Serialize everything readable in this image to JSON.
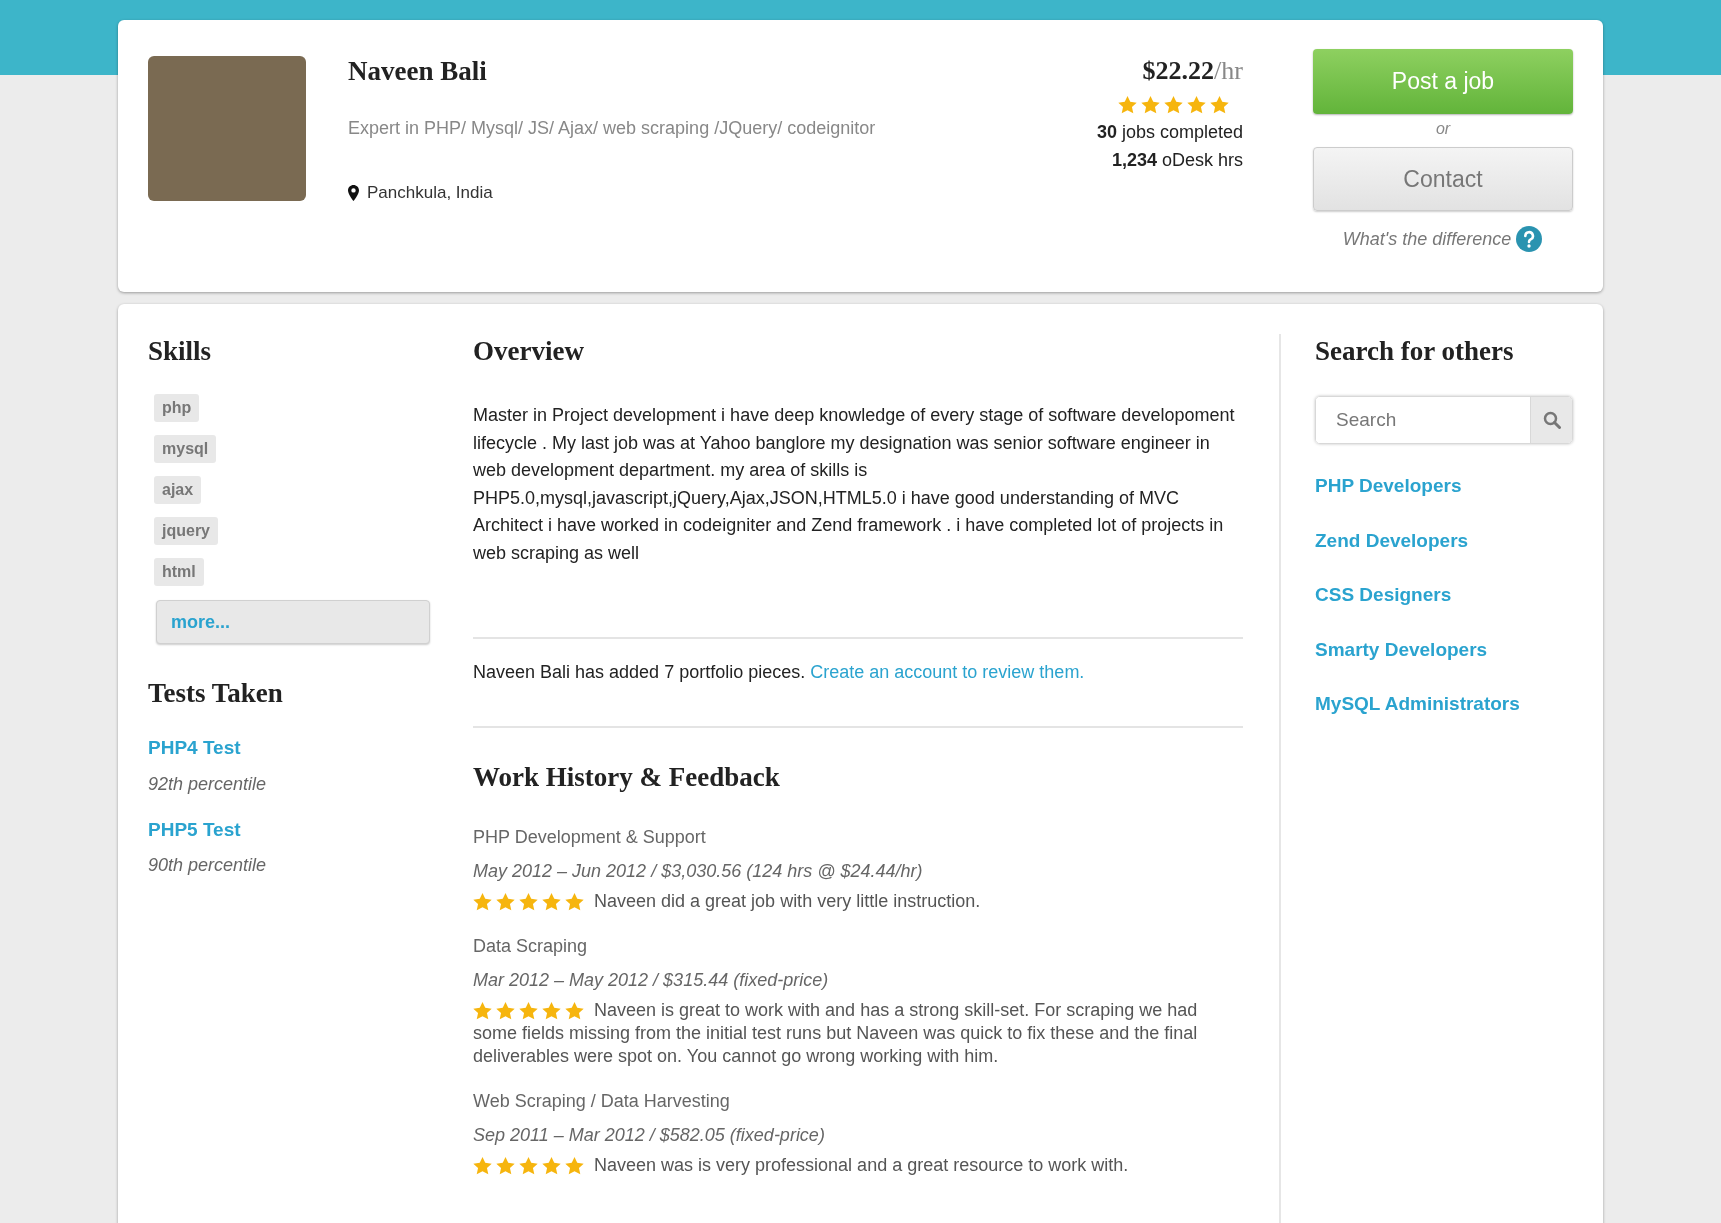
{
  "profile": {
    "name": "Naveen Bali",
    "tagline": "Expert in PHP/ Mysql/ JS/ Ajax/ web scraping /JQuery/ codeignitor",
    "location": "Panchkula, India",
    "rate": "$22.22",
    "rate_unit": "/hr",
    "stars": 5,
    "jobs_completed": "**30** jobs completed",
    "hours": "**1,234** oDesk hrs"
  },
  "actions": {
    "primary": "Post a job",
    "separator": "or",
    "secondary": "Contact",
    "help_link": "What's the difference"
  },
  "skills": {
    "title": "Skills",
    "tags": [
      "php",
      "mysql",
      "ajax",
      "jquery",
      "html"
    ],
    "more": "more..."
  },
  "tests": {
    "title": "Tests Taken",
    "items": [
      {
        "name": "PHP4 Test",
        "result": "92th percentile"
      },
      {
        "name": "PHP5 Test",
        "result": "90th percentile"
      }
    ]
  },
  "overview": {
    "title": "Overview",
    "text": "Master in Project development i have deep knowledge of every stage of software developoment lifecycle . My last job was at Yahoo banglore my designation was senior software engineer in web development department. my area of skills is PHP5.0,mysql,javascript,jQuery,Ajax,JSON,HTML5.0 i have good understanding of MVC Architect i have worked in codeigniter and Zend framework . i have completed lot of projects in web scraping as well",
    "portfolio_note": "Naveen Bali has added 7 portfolio pieces.",
    "portfolio_link": "Create an account to review them."
  },
  "work_history": {
    "title": "Work History & Feedback",
    "jobs": [
      {
        "title": "PHP Development & Support",
        "details": "May 2012 – Jun 2012 / $3,030.56  (124 hrs @ $24.44/hr)",
        "stars": 5,
        "feedback": "Naveen did a great job with very little instruction."
      },
      {
        "title": "Data Scraping",
        "details": "Mar 2012 – May 2012 / $315.44 (fixed-price)",
        "stars": 5,
        "feedback": "Naveen is great to work with and has a strong skill-set. For scraping we had some fields missing from the initial test runs but Naveen was quick to fix these and the final deliverables were spot on. You cannot go wrong working with him."
      },
      {
        "title": "Web Scraping / Data Harvesting",
        "details": "Sep 2011 – Mar 2012 / $582.05 (fixed-price)",
        "stars": 5,
        "feedback": "Naveen was is very professional and a great resource to work with."
      }
    ]
  },
  "search_others": {
    "title": "Search for others",
    "search": {
      "placeholder": "Search"
    },
    "links": [
      "PHP Developers",
      "Zend Developers",
      "CSS Designers",
      "Smarty Developers",
      "MySQL Administrators"
    ]
  }
}
